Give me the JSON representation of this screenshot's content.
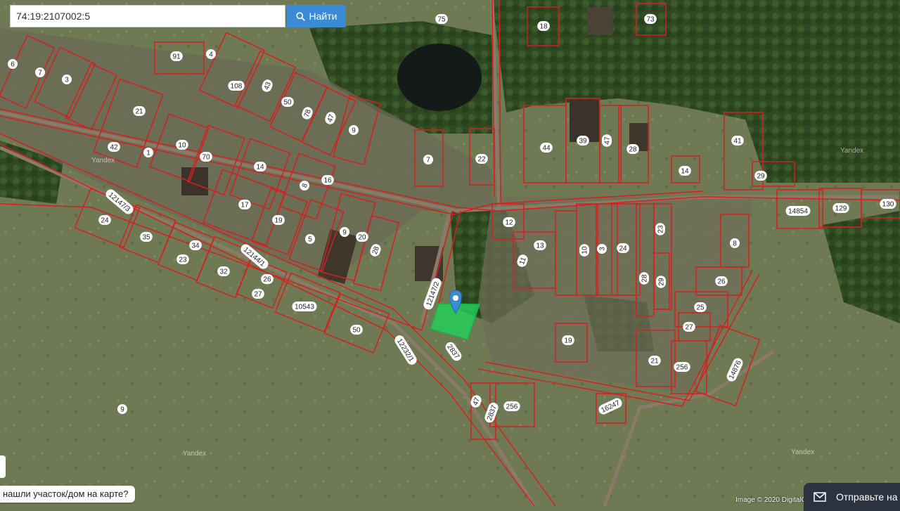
{
  "search": {
    "value": "74:19:2107002:5",
    "button_label": "Найти"
  },
  "help_text": "нашли участок/дом на карте?",
  "chat_label": "Отправьте на",
  "copyright": "Image © 2020 DigitalG",
  "watermark": "Yandex",
  "colors": {
    "boundary": "#d62020",
    "selected": "#22d35a",
    "accent": "#3b8ad6"
  },
  "parcel_labels": [
    "12147/3",
    "12144/1",
    "12232/1",
    "12147/2",
    "2837",
    "10543",
    "14854",
    "14876",
    "16247",
    "129",
    "130",
    "108",
    "91",
    "73",
    "75",
    "18",
    "44",
    "39",
    "47",
    "28",
    "14",
    "41",
    "29",
    "6",
    "7",
    "3",
    "4",
    "43",
    "50",
    "78",
    "47",
    "9",
    "7",
    "22",
    "21",
    "42",
    "1",
    "10",
    "70",
    "14",
    "8",
    "16",
    "17",
    "19",
    "5",
    "9",
    "20",
    "28",
    "24",
    "35",
    "34",
    "23",
    "32",
    "26",
    "27",
    "50",
    "9",
    "12",
    "13",
    "11",
    "10",
    "3",
    "24",
    "28",
    "29",
    "23",
    "26",
    "25",
    "27",
    "8",
    "19",
    "21",
    "256",
    "256",
    "2837",
    "47"
  ]
}
